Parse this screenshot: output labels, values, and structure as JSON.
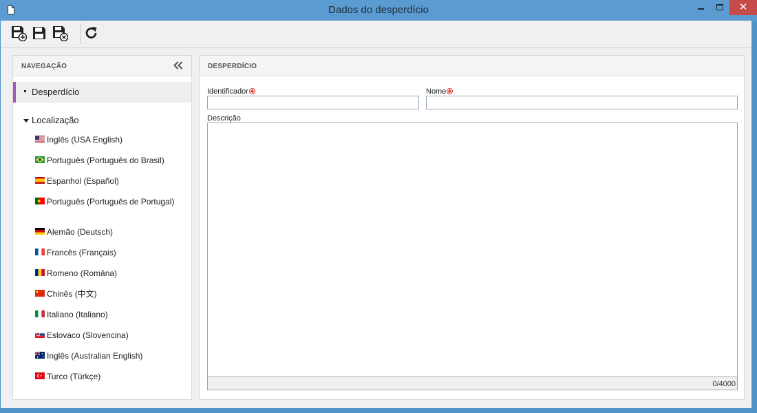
{
  "window": {
    "title": "Dados do desperdício",
    "close_glyph": "✕"
  },
  "toolbar": {
    "buttons": [
      {
        "name": "save-and-new-button",
        "icon": "save-plus-icon"
      },
      {
        "name": "save-button",
        "icon": "floppy-disk-icon"
      },
      {
        "name": "save-and-close-button",
        "icon": "save-close-icon"
      },
      {
        "name": "refresh-button",
        "icon": "refresh-icon"
      }
    ]
  },
  "navigation": {
    "header": "NAVEGAÇÃO",
    "main_item": "Desperdício",
    "section_label": "Localização",
    "accent_color": "#9f5bb5",
    "languages": [
      {
        "label": "Inglês (USA English)",
        "flag": "us-flag-icon"
      },
      {
        "label": "Português (Português do Brasil)",
        "flag": "brazil-flag-icon"
      },
      {
        "label": "Espanhol (Español)",
        "flag": "spain-flag-icon"
      },
      {
        "label": "Português (Português de Portugal)",
        "flag": "portugal-flag-icon"
      },
      {
        "label": "Alemão (Deutsch)",
        "flag": "germany-flag-icon"
      },
      {
        "label": "Francês (Français)",
        "flag": "france-flag-icon"
      },
      {
        "label": "Romeno (Româna)",
        "flag": "romania-flag-icon"
      },
      {
        "label": "Chinês (中文)",
        "flag": "china-flag-icon"
      },
      {
        "label": "Italiano (Italiano)",
        "flag": "italy-flag-icon"
      },
      {
        "label": "Eslovaco (Slovencina)",
        "flag": "slovakia-flag-icon"
      },
      {
        "label": "Inglês (Australian English)",
        "flag": "australia-flag-icon"
      },
      {
        "label": "Turco (Türkçe)",
        "flag": "turkey-flag-icon"
      }
    ]
  },
  "form": {
    "header": "DESPERDÍCIO",
    "identifier_label": "Identificador",
    "identifier_value": "",
    "name_label": "Nome",
    "name_value": "",
    "description_label": "Descrição",
    "description_value": "",
    "char_counter": "0/4000",
    "required_color": "#d9342b"
  }
}
